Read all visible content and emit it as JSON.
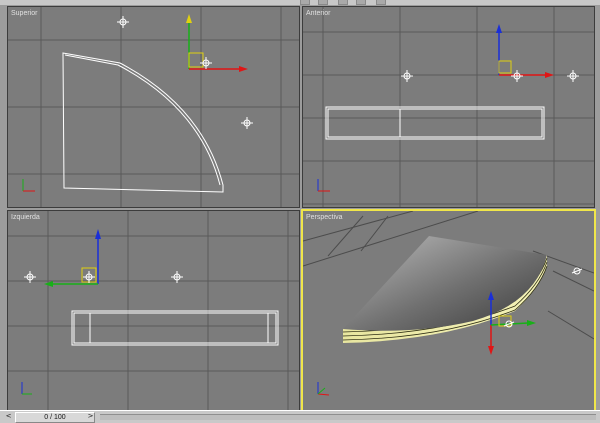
{
  "viewports": {
    "top": {
      "label": "Superior"
    },
    "front": {
      "label": "Anterior"
    },
    "left": {
      "label": "Izquierda"
    },
    "perspective": {
      "label": "Perspectiva"
    }
  },
  "timeline": {
    "frame": "0 / 100",
    "prev_glyph": "<",
    "next_glyph": ">"
  },
  "colors": {
    "viewport_bg": "#7c7c7c",
    "grid_line": "#5a5a5a",
    "active_border": "#f0e64a",
    "wire": "#ffffff",
    "axis_x": "#e01515",
    "axis_y": "#18b018",
    "axis_z": "#1a2fd8"
  },
  "icons": [
    "gizmo-icon",
    "axis-tripod-icon",
    "helper-crosshair-icon"
  ]
}
